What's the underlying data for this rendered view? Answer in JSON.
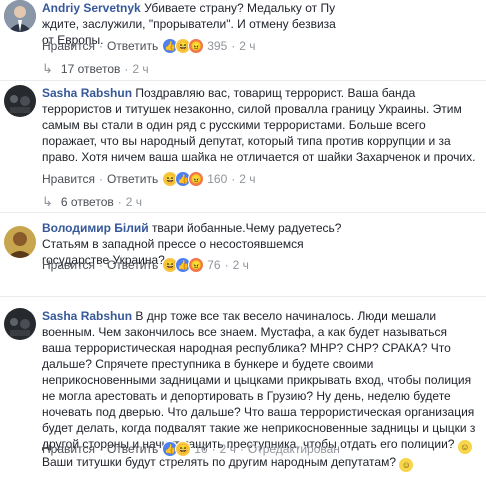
{
  "comments": [
    {
      "author": "Andriy Servetnyk",
      "text": "Убиваете страну? Медальку от Пу ждите, заслужили, \"прорыватели\". И отмену безвиза от Европы.",
      "like": "Нравится",
      "reply": "Ответить",
      "reaction_count": "395",
      "time": "2 ч",
      "replies_label": "17 ответов",
      "replies_time": "2 ч"
    },
    {
      "author": "Sasha Rabshun",
      "text": "Поздравляю вас, товарищ террорист. Ваша банда террористов и титушек незаконно, силой провалла границу Украины. Этим самым вы стали в один ряд с русскими террористами. Больше всего поражает, что вы народный депутат, который типа против коррупции и за право. Хотя ничем ваша шайка не отличается от шайки Захарченок и прочих.",
      "like": "Нравится",
      "reply": "Ответить",
      "reaction_count": "160",
      "time": "2 ч",
      "replies_label": "6 ответов",
      "replies_time": "2 ч"
    },
    {
      "author": "Володимир Білий",
      "text": "твари йобанные.Чему радуетесь? Статьям в западной прессе о несостоявшемся государстве Украина?",
      "like": "Нравится",
      "reply": "Ответить",
      "reaction_count": "76",
      "time": "2 ч"
    },
    {
      "author": "Sasha Rabshun",
      "text": "В днр тоже все так весело начиналось. Люди мешали военным. Чем закончилось все знаем. Мустафа, а как будет называться ваша террористическая народная республика? МНР? СНР? СРАКА? Что дальше? Спрячете преступника в бункере и будете своими неприкосновенными задницами и цыцками прикрывать вход, чтобы полиция не могла арестовать и депортировать в Грузию? Ну день, неделю будете ночевать под дверью. Что дальше? Что ваша террористическая организация будет делать, когда подвалят такие же неприкосновенные задницы и цыцки з другой стороны и начнут тащить преступника, чтобы отдать его полиции?",
      "text2": "Ваши титушки будут стрелять по другим народным депутатам?",
      "like": "Нравится",
      "reply": "Ответить",
      "reaction_count": "16",
      "time": "2 ч",
      "edited": "Отредактирован"
    }
  ]
}
